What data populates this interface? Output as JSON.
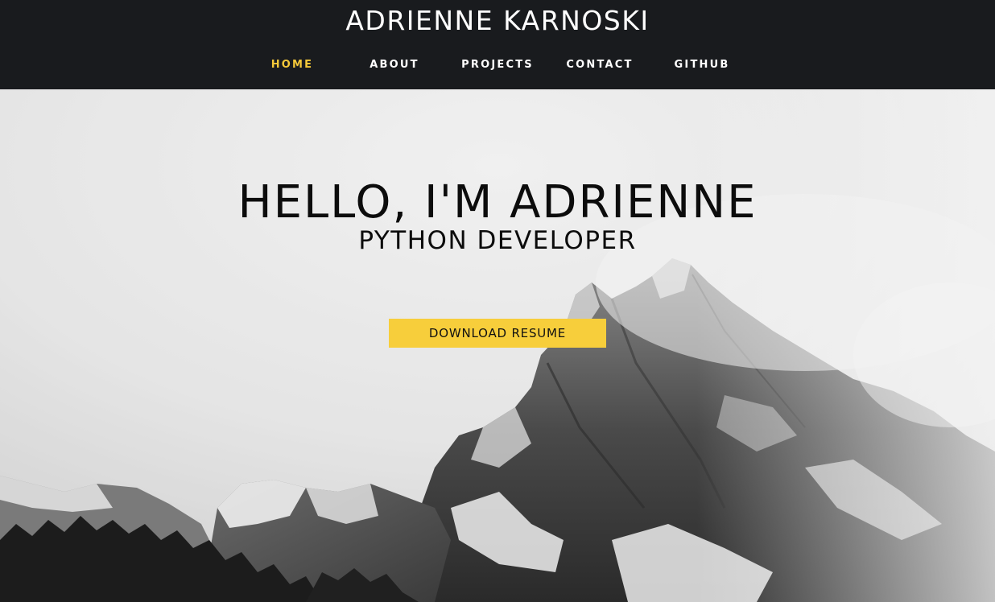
{
  "header": {
    "site_title": "ADRIENNE KARNOSKI",
    "nav": [
      {
        "label": "HOME",
        "active": true
      },
      {
        "label": "ABOUT",
        "active": false
      },
      {
        "label": "PROJECTS",
        "active": false
      },
      {
        "label": "CONTACT",
        "active": false
      },
      {
        "label": "GITHUB",
        "active": false
      }
    ]
  },
  "hero": {
    "title": "HELLO, I'M ADRIENNE",
    "subtitle": "PYTHON DEVELOPER",
    "button_label": "DOWNLOAD RESUME",
    "background": "mountain-photo-grayscale"
  },
  "colors": {
    "header_bg": "#191b1e",
    "accent": "#f5c93a",
    "button_bg": "#f7ce3b",
    "text_dark": "#0c0c0c"
  }
}
